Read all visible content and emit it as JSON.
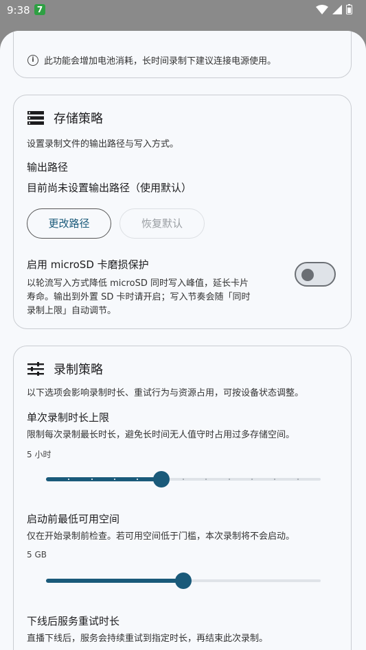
{
  "status_bar": {
    "time": "9:38",
    "badge": "7"
  },
  "top_card": {
    "info_text": "此功能会增加电池消耗，长时间录制下建议连接电源使用。"
  },
  "storage": {
    "title": "存储策略",
    "description": "设置录制文件的输出路径与写入方式。",
    "output_label": "输出路径",
    "output_value": "目前尚未设置输出路径（使用默认）",
    "change_button": "更改路径",
    "reset_button": "恢复默认",
    "microsd_label": "启用 microSD 卡磨损保护",
    "microsd_desc_1": "以轮流写入方式降低 microSD 同时写入峰值，延长卡片",
    "microsd_desc_2": "寿命。输出到外置 SD 卡时请开启；写入节奏会随「同时",
    "microsd_desc_3": "录制上限」自动调节。",
    "microsd_enabled": false
  },
  "record": {
    "title": "录制策略",
    "description": "以下选项会影响录制时长、重试行为与资源占用，可按设备状态调整。",
    "max_duration": {
      "label": "单次录制时长上限",
      "desc": "限制每次录制最长时长，避免长时间无人值守时占用过多存储空间。",
      "value_text": "5 小时",
      "fraction": 0.42,
      "steps": 12
    },
    "min_space": {
      "label": "启动前最低可用空间",
      "desc": "仅在开始录制前检查。若可用空间低于门槛，本次录制将不会启动。",
      "value_text": "5 GB",
      "fraction": 0.5
    },
    "retry": {
      "label": "下线后服务重试时长",
      "desc": "直播下线后，服务会持续重试到指定时长，再结束此次录制。"
    }
  },
  "colors": {
    "accent": "#1a5a7a",
    "track": "#dfe3e8"
  }
}
